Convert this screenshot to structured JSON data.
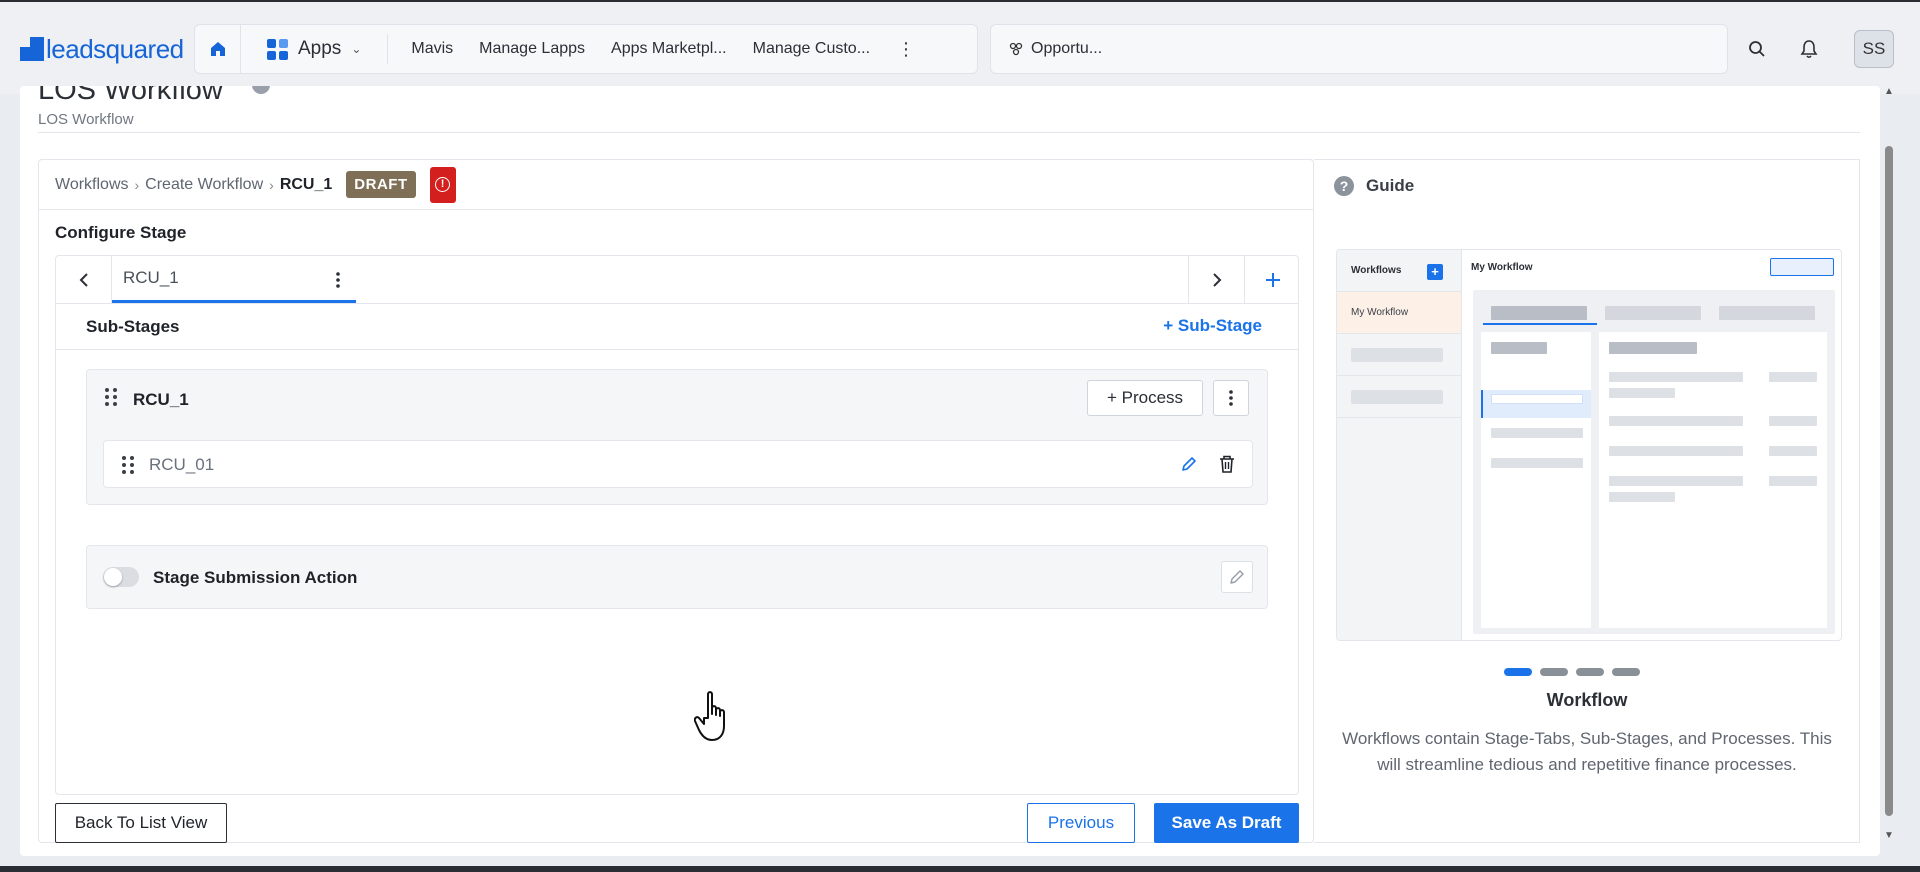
{
  "topnav": {
    "logo": "leadsquared",
    "apps_label": "Apps",
    "links": [
      "Mavis",
      "Manage Lapps",
      "Apps Marketpl...",
      "Manage Custo..."
    ],
    "search_text": "Opportu...",
    "avatar": "SS"
  },
  "page": {
    "title": "LOS Workflow",
    "subtitle": "LOS Workflow"
  },
  "breadcrumb": {
    "items": [
      "Workflows",
      "Create Workflow"
    ],
    "current": "RCU_1",
    "status_badge": "DRAFT"
  },
  "configure": {
    "section_title": "Configure Stage",
    "active_tab": "RCU_1",
    "substages_title": "Sub-Stages",
    "add_substage_label": "+ Sub-Stage",
    "substage": {
      "name": "RCU_1",
      "add_process_label": "+ Process",
      "process_name": "RCU_01"
    },
    "submission_action_label": "Stage Submission Action",
    "submission_action_enabled": false
  },
  "footer": {
    "back_label": "Back To List View",
    "previous_label": "Previous",
    "save_label": "Save As Draft"
  },
  "guide": {
    "title": "Guide",
    "preview": {
      "sidebar_title": "Workflows",
      "sidebar_item": "My Workflow",
      "main_title": "My Workflow"
    },
    "carousel_total": 4,
    "carousel_active": 1,
    "card_title": "Workflow",
    "description": "Workflows contain Stage-Tabs, Sub-Stages, and Processes. This will streamline tedious and repetitive finance processes."
  },
  "colors": {
    "brand_blue": "#1a73e8",
    "draft_badge": "#7e6f56",
    "error_badge": "#d3201f"
  }
}
